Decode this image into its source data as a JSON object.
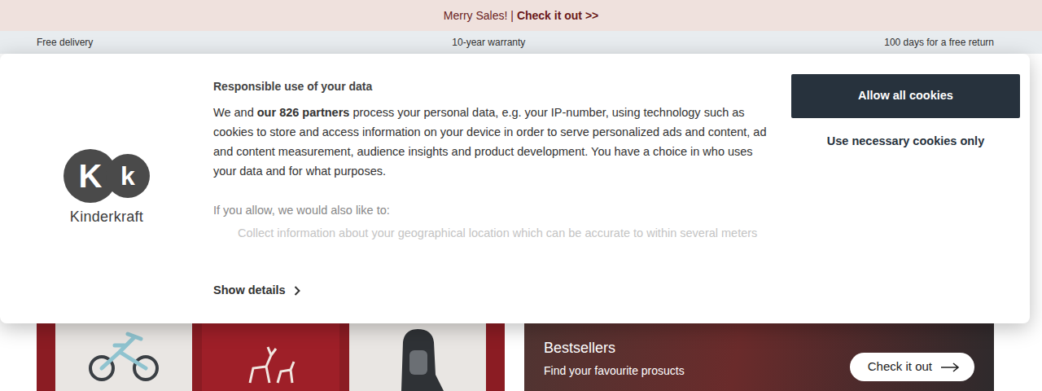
{
  "promo": {
    "text": "Merry Sales! |",
    "link": "Check it out >>"
  },
  "usps": [
    "Free delivery",
    "10-year warranty",
    "100 days for a free return"
  ],
  "cookie_dialog": {
    "logo": {
      "mark": [
        "K",
        "k"
      ],
      "name": "Kinderkraft"
    },
    "title": "Responsible use of your data",
    "intro_before": "We and ",
    "partners": "our 826 partners",
    "intro_after": " process your personal data, e.g. your IP-number, using technology such as cookies to store and access information on your device in order to serve personalized ads and content, ad and content measurement, audience insights and product development. You have a choice in who uses your data and for what purposes.",
    "allow_label": "If you allow, we would also like to:",
    "purposes": [
      "Collect information about your geographical location which can be accurate to within several meters"
    ],
    "details": "Show details",
    "buttons": [
      "Allow all cookies",
      "Use necessary cookies only"
    ]
  },
  "banners": [
    {
      "title": "Bestsellers",
      "subtitle": "Find your favourite prosucts",
      "button": "Check it out"
    }
  ]
}
